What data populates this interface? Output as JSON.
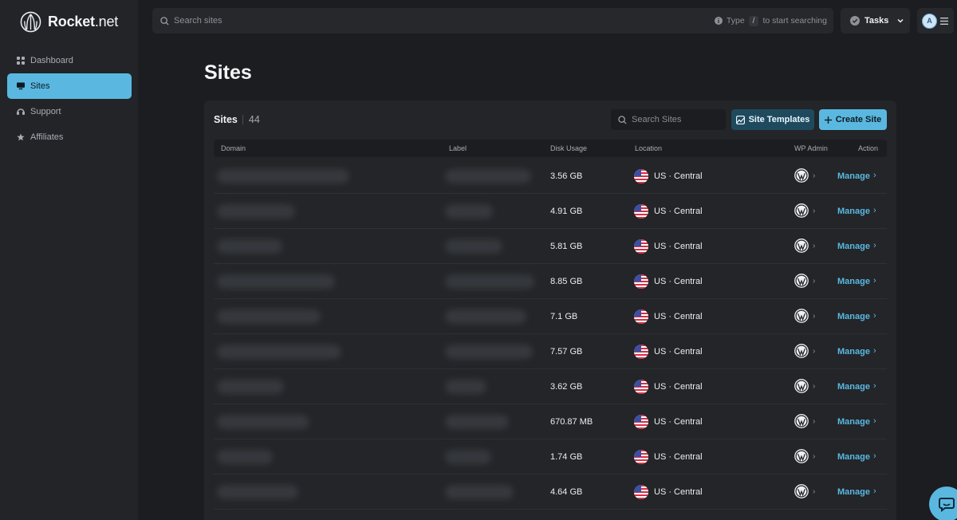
{
  "app": {
    "brand_bold": "Rocket",
    "brand_light": ".net"
  },
  "sidebar": {
    "items": [
      {
        "label": "Dashboard",
        "icon": "grid-icon",
        "active": false
      },
      {
        "label": "Sites",
        "icon": "monitor-icon",
        "active": true
      },
      {
        "label": "Support",
        "icon": "support-icon",
        "active": false
      },
      {
        "label": "Affiliates",
        "icon": "star-icon",
        "active": false
      }
    ]
  },
  "topbar": {
    "search_placeholder": "Search sites",
    "hint_prefix": "Type",
    "hint_key": "/",
    "hint_suffix": "to start searching",
    "tasks_label": "Tasks",
    "avatar_initial": "A"
  },
  "page": {
    "title": "Sites"
  },
  "card": {
    "title": "Sites",
    "count": "44",
    "search_placeholder": "Search Sites",
    "templates_label": "Site Templates",
    "create_label": "Create Site"
  },
  "table": {
    "columns": [
      "Domain",
      "Label",
      "Disk Usage",
      "Location",
      "WP Admin",
      "Action"
    ],
    "rows": [
      {
        "disk": "3.56 GB",
        "location": "US · Central",
        "action": "Manage"
      },
      {
        "disk": "4.91 GB",
        "location": "US · Central",
        "action": "Manage"
      },
      {
        "disk": "5.81 GB",
        "location": "US · Central",
        "action": "Manage"
      },
      {
        "disk": "8.85 GB",
        "location": "US · Central",
        "action": "Manage"
      },
      {
        "disk": "7.1 GB",
        "location": "US · Central",
        "action": "Manage"
      },
      {
        "disk": "7.57 GB",
        "location": "US · Central",
        "action": "Manage"
      },
      {
        "disk": "3.62 GB",
        "location": "US · Central",
        "action": "Manage"
      },
      {
        "disk": "670.87 MB",
        "location": "US · Central",
        "action": "Manage"
      },
      {
        "disk": "1.74 GB",
        "location": "US · Central",
        "action": "Manage"
      },
      {
        "disk": "4.64 GB",
        "location": "US · Central",
        "action": "Manage"
      }
    ]
  },
  "colors": {
    "accent": "#5ab8e0",
    "background": "#1b1d20",
    "sidebar": "#222427",
    "card": "#232528"
  }
}
